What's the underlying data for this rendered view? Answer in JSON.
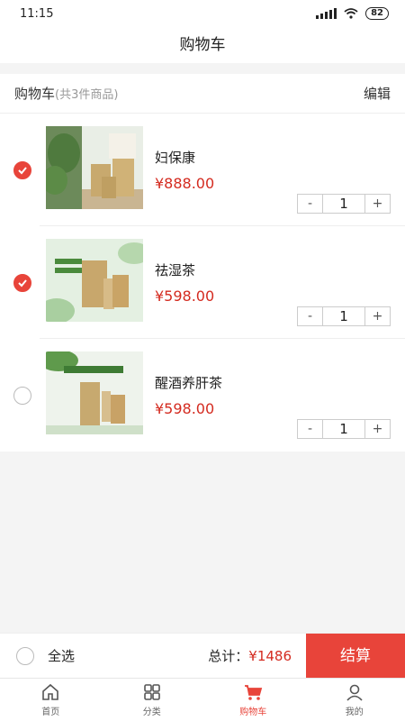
{
  "status": {
    "time": "11:15",
    "battery": "82"
  },
  "header": {
    "title": "购物车"
  },
  "cart": {
    "title": "购物车",
    "count_text": "(共3件商品)",
    "edit_label": "编辑",
    "items": [
      {
        "name": "妇保康",
        "price": "¥888.00",
        "quantity": "1",
        "checked": true,
        "minus": "-",
        "plus": "+"
      },
      {
        "name": "祛湿茶",
        "price": "¥598.00",
        "quantity": "1",
        "checked": true,
        "minus": "-",
        "plus": "+"
      },
      {
        "name": "醒酒养肝茶",
        "price": "¥598.00",
        "quantity": "1",
        "checked": false,
        "minus": "-",
        "plus": "+"
      }
    ]
  },
  "footer": {
    "select_all": "全选",
    "total_label": "总计：",
    "total_amount": "¥1486",
    "checkout": "结算"
  },
  "tabbar": {
    "items": [
      {
        "label": "首页",
        "icon": "home-icon"
      },
      {
        "label": "分类",
        "icon": "category-icon"
      },
      {
        "label": "购物车",
        "icon": "cart-icon",
        "active": true
      },
      {
        "label": "我的",
        "icon": "user-icon"
      }
    ]
  },
  "colors": {
    "accent": "#e8443a",
    "price": "#d42b20"
  }
}
